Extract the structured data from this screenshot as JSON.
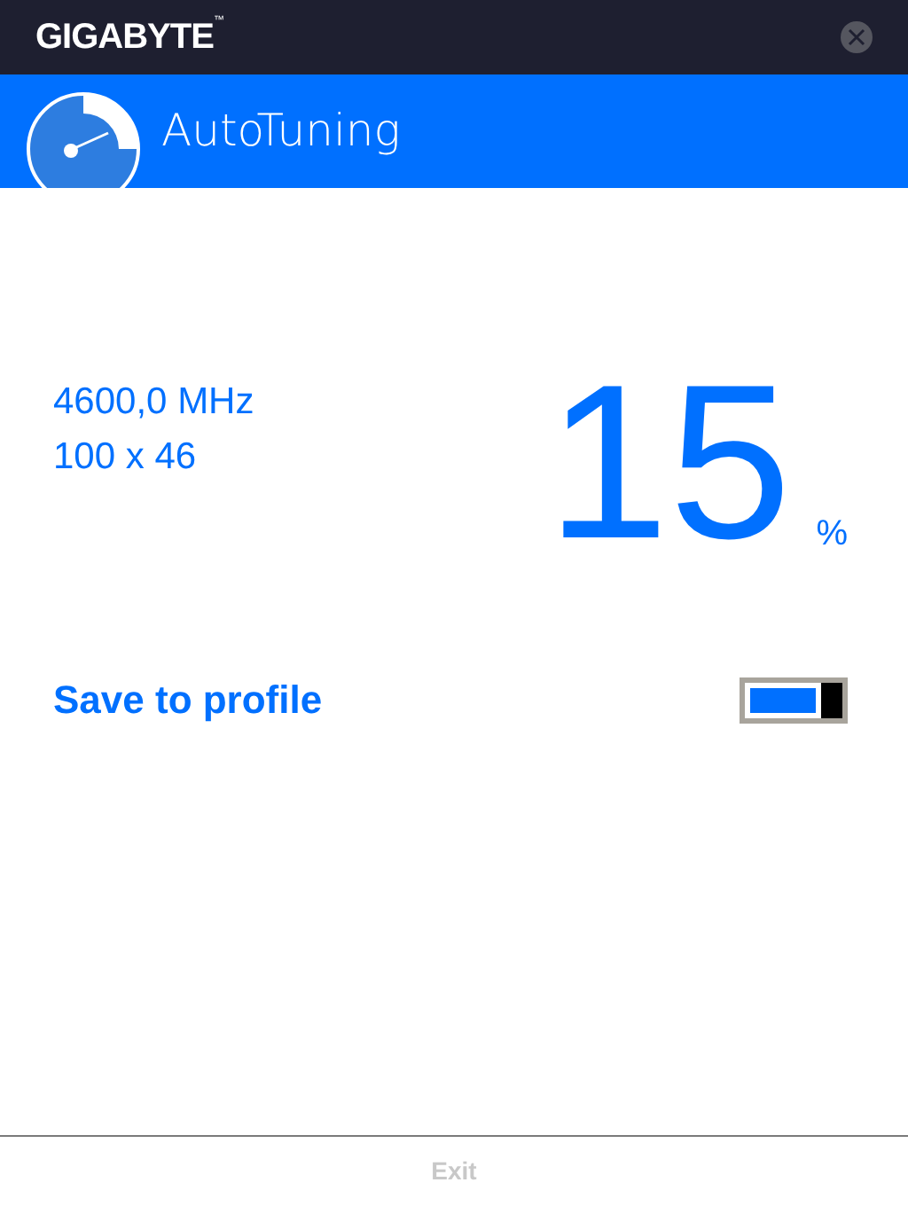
{
  "window": {
    "brand": "GIGABYTE",
    "trademark": "™"
  },
  "header": {
    "title": "AutoTuning"
  },
  "readings": [
    "4600,0 MHz",
    "100 x 46"
  ],
  "percent": {
    "value": "15",
    "unit": "%"
  },
  "save_to_profile": {
    "label": "Save to profile",
    "on": true
  },
  "footer": {
    "exit": {
      "label": "Exit",
      "disabled": true
    }
  }
}
